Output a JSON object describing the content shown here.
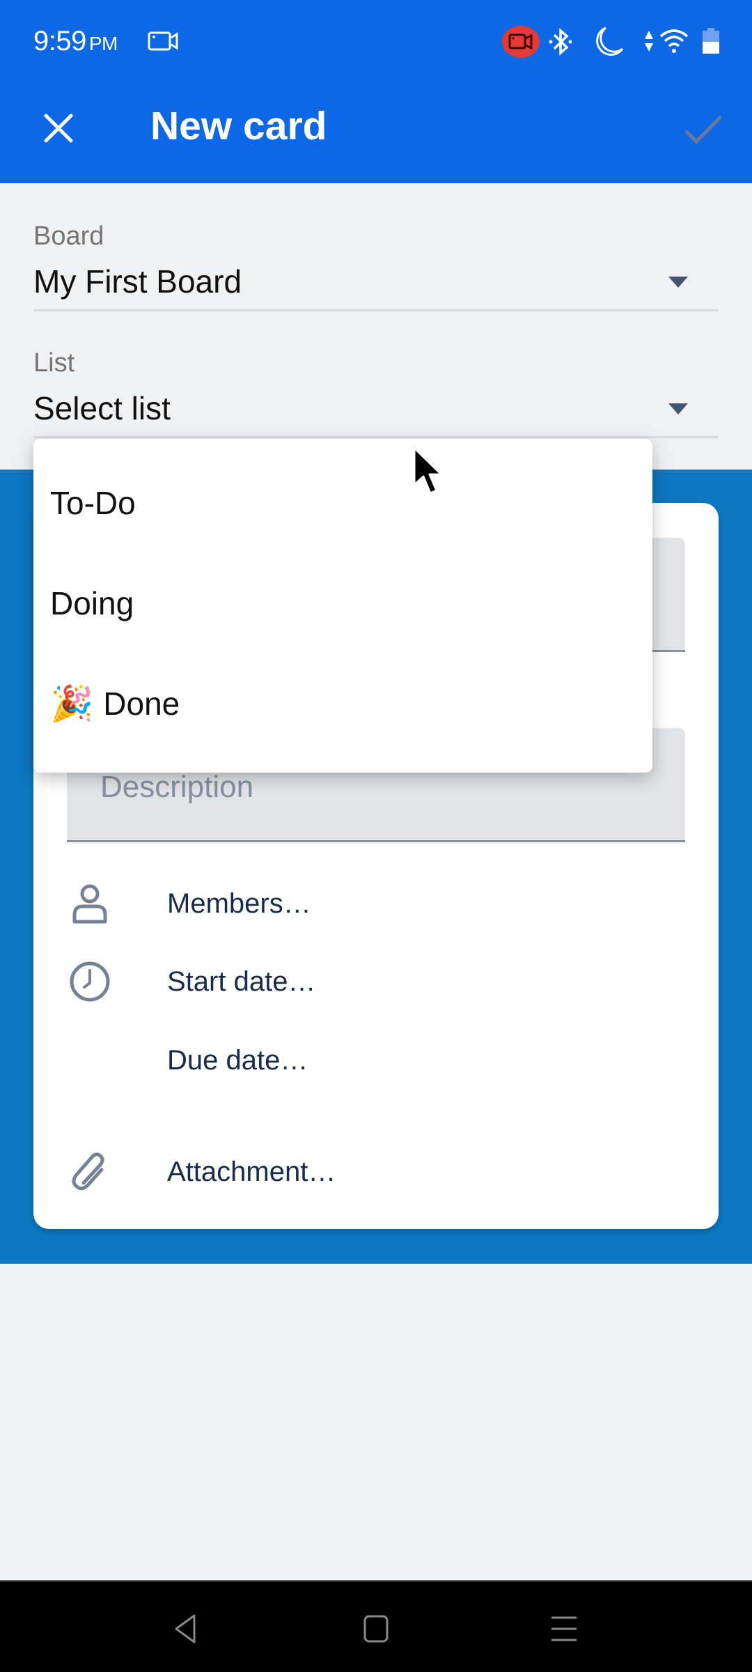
{
  "status_bar": {
    "time": "9:59",
    "ampm": "PM",
    "icons": [
      "screen-record-icon",
      "recording-indicator-icon",
      "bluetooth-icon",
      "do-not-disturb-moon-icon",
      "data-arrows-icon",
      "wifi-icon",
      "battery-icon"
    ],
    "recording_color": "#e53935"
  },
  "app_bar": {
    "title": "New card",
    "close_icon": "close-icon",
    "confirm_icon": "check-icon",
    "confirm_enabled": false,
    "color": "#0c68e4"
  },
  "form": {
    "board": {
      "label": "Board",
      "value": "My First Board"
    },
    "list": {
      "label": "List",
      "value": "Select list"
    }
  },
  "dropdown": {
    "options": [
      {
        "label": "To-Do",
        "emoji": ""
      },
      {
        "label": "Doing",
        "emoji": ""
      },
      {
        "label": "Done",
        "emoji": "🎉"
      }
    ]
  },
  "card": {
    "name_placeholder": "",
    "description_placeholder": "Description",
    "rows": [
      {
        "label": "Members…",
        "icon": "person-icon"
      },
      {
        "label": "Start date…",
        "icon": "clock-icon"
      },
      {
        "label": "Due date…",
        "icon": ""
      },
      {
        "label": "Attachment…",
        "icon": "paperclip-icon"
      }
    ],
    "board_color": "#0c77c2"
  },
  "nav_bar": {
    "buttons": [
      "back-icon",
      "home-icon",
      "recents-icon"
    ]
  }
}
